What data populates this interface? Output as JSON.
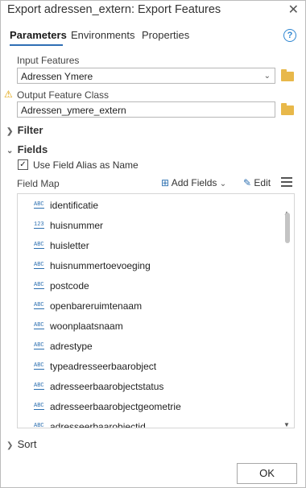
{
  "title": "Export adressen_extern: Export Features",
  "close_glyph": "✕",
  "tabs": [
    "Parameters",
    "Environments",
    "Properties"
  ],
  "help_glyph": "?",
  "input_features": {
    "label": "Input Features",
    "value": "Adressen Ymere"
  },
  "output_class": {
    "label": "Output Feature Class",
    "value": "Adressen_ymere_extern"
  },
  "sections": {
    "filter": "Filter",
    "fields": "Fields",
    "sort": "Sort"
  },
  "use_alias": {
    "label": "Use Field Alias as Name",
    "checked": true
  },
  "field_map": {
    "label": "Field Map",
    "add_fields": "Add Fields",
    "edit": "Edit",
    "rows": [
      {
        "type": "ABC",
        "name": "identificatie"
      },
      {
        "type": "123",
        "name": "huisnummer"
      },
      {
        "type": "ABC",
        "name": "huisletter"
      },
      {
        "type": "ABC",
        "name": "huisnummertoevoeging"
      },
      {
        "type": "ABC",
        "name": "postcode"
      },
      {
        "type": "ABC",
        "name": "openbareruimtenaam"
      },
      {
        "type": "ABC",
        "name": "woonplaatsnaam"
      },
      {
        "type": "ABC",
        "name": "adrestype"
      },
      {
        "type": "ABC",
        "name": "typeadresseerbaarobject"
      },
      {
        "type": "ABC",
        "name": "adresseerbaarobjectstatus"
      },
      {
        "type": "ABC",
        "name": "adresseerbaarobjectgeometrie"
      },
      {
        "type": "ABC",
        "name": "adresseerbaarobjectid"
      }
    ]
  },
  "ok_label": "OK"
}
